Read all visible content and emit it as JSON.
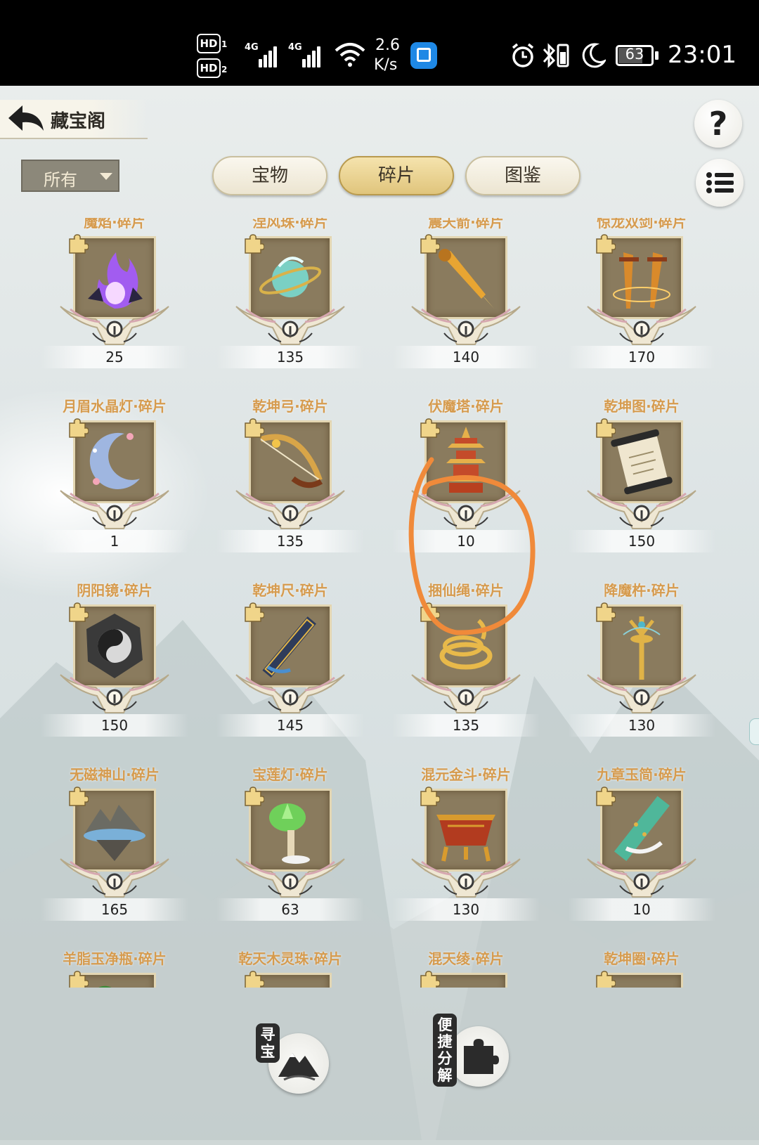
{
  "status_bar": {
    "hd1": "HD",
    "hd1_sub": "1",
    "hd2": "HD",
    "hd2_sub": "2",
    "net1": "4G",
    "net2": "4G",
    "speed_value": "2.6",
    "speed_unit": "K/s",
    "battery": "63",
    "time": "23:01"
  },
  "header": {
    "title": "藏宝阁",
    "help": "?"
  },
  "filter": {
    "selected": "所有"
  },
  "tabs": [
    {
      "label": "宝物",
      "active": false
    },
    {
      "label": "碎片",
      "active": true
    },
    {
      "label": "图鉴",
      "active": false
    }
  ],
  "items": [
    {
      "name": "魔焰·碎片",
      "count": "25",
      "icon": "purple-flame",
      "color": "#a25cf0"
    },
    {
      "name": "涅风珠·碎片",
      "count": "135",
      "icon": "wind-orb",
      "color": "#7ad0c4"
    },
    {
      "name": "震天箭·碎片",
      "count": "140",
      "icon": "golden-arrow",
      "color": "#e8a532"
    },
    {
      "name": "惊龙双剑·碎片",
      "count": "170",
      "icon": "twin-swords",
      "color": "#d98a2b"
    },
    {
      "name": "月眉水晶灯·碎片",
      "count": "1",
      "icon": "crescent-lamp",
      "color": "#9fb6e0"
    },
    {
      "name": "乾坤弓·碎片",
      "count": "135",
      "icon": "bow",
      "color": "#d8a548"
    },
    {
      "name": "伏魔塔·碎片",
      "count": "10",
      "icon": "pagoda",
      "color": "#e6b04a"
    },
    {
      "name": "乾坤图·碎片",
      "count": "150",
      "icon": "scroll",
      "color": "#efe6cf"
    },
    {
      "name": "阴阳镜·碎片",
      "count": "150",
      "icon": "yin-yang-mirror",
      "color": "#d9d9d9"
    },
    {
      "name": "乾坤尺·碎片",
      "count": "145",
      "icon": "ruler",
      "color": "#4a8fd0"
    },
    {
      "name": "捆仙绳·碎片",
      "count": "135",
      "icon": "golden-rope",
      "color": "#e8b94a"
    },
    {
      "name": "降魔杵·碎片",
      "count": "130",
      "icon": "vajra",
      "color": "#e0b347"
    },
    {
      "name": "无磁神山·碎片",
      "count": "165",
      "icon": "floating-mountain",
      "color": "#7ab0d8"
    },
    {
      "name": "宝莲灯·碎片",
      "count": "63",
      "icon": "lotus-lamp",
      "color": "#6fd05a"
    },
    {
      "name": "混元金斗·碎片",
      "count": "130",
      "icon": "golden-cauldron",
      "color": "#d99b2e"
    },
    {
      "name": "九章玉简·碎片",
      "count": "10",
      "icon": "jade-slip",
      "color": "#4fb79a"
    },
    {
      "name": "羊脂玉净瓶·碎片",
      "count": "",
      "icon": "jade-vase",
      "color": "#eaeaea"
    },
    {
      "name": "乾天木灵珠·碎片",
      "count": "",
      "icon": "wood-orb",
      "color": "#6ccc3a"
    },
    {
      "name": "混天绫·碎片",
      "count": "",
      "icon": "red-sash",
      "color": "#e0552d"
    },
    {
      "name": "乾坤圈·碎片",
      "count": "",
      "icon": "golden-ring",
      "color": "#e8c040"
    }
  ],
  "bottom": {
    "seek_label": "寻宝",
    "decompose_label": "便捷分解"
  },
  "annotation": {
    "color": "#f08a3a"
  }
}
